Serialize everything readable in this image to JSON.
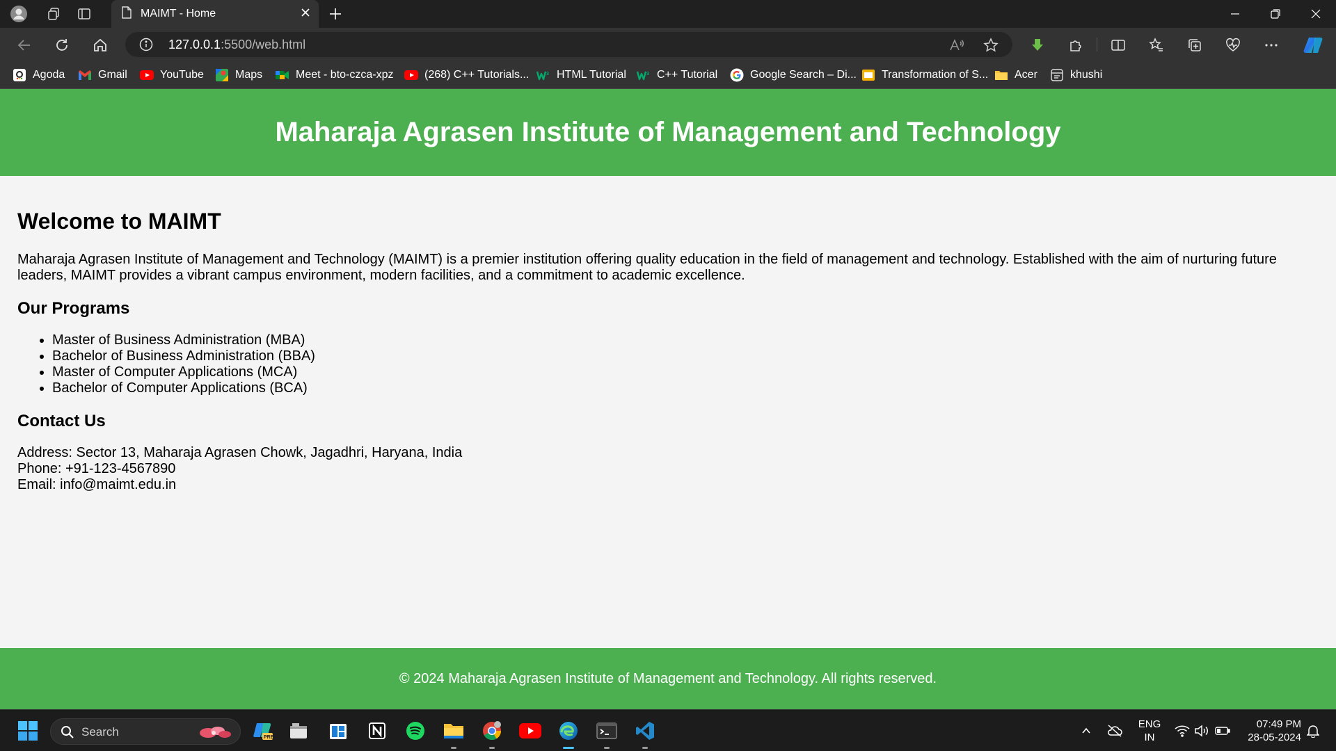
{
  "browser": {
    "tab_title": "MAIMT - Home",
    "url_host": "127.0.0.1",
    "url_path": ":5500/web.html",
    "favorites": [
      {
        "label": "Agoda",
        "icon": "agoda-icon"
      },
      {
        "label": "Gmail",
        "icon": "gmail-icon"
      },
      {
        "label": "YouTube",
        "icon": "youtube-icon"
      },
      {
        "label": "Maps",
        "icon": "maps-icon"
      },
      {
        "label": "Meet - bto-czca-xpz",
        "icon": "meet-icon"
      },
      {
        "label": "(268) C++ Tutorials...",
        "icon": "youtube-icon"
      },
      {
        "label": "HTML Tutorial",
        "icon": "w3schools-icon"
      },
      {
        "label": "C++ Tutorial",
        "icon": "w3schools-icon"
      },
      {
        "label": "Google Search – Di...",
        "icon": "google-icon"
      },
      {
        "label": "Transformation of S...",
        "icon": "slides-icon"
      },
      {
        "label": "Acer",
        "icon": "folder-icon"
      },
      {
        "label": "khushi",
        "icon": "app-icon"
      }
    ]
  },
  "site": {
    "header_title": "Maharaja Agrasen Institute of Management and Technology",
    "welcome_heading": "Welcome to MAIMT",
    "intro_paragraph": "Maharaja Agrasen Institute of Management and Technology (MAIMT) is a premier institution offering quality education in the field of management and technology. Established with the aim of nurturing future leaders, MAIMT provides a vibrant campus environment, modern facilities, and a commitment to academic excellence.",
    "programs_heading": "Our Programs",
    "programs": [
      "Master of Business Administration (MBA)",
      "Bachelor of Business Administration (BBA)",
      "Master of Computer Applications (MCA)",
      "Bachelor of Computer Applications (BCA)"
    ],
    "contact_heading": "Contact Us",
    "contact": {
      "address": "Address: Sector 13, Maharaja Agrasen Chowk, Jagadhri, Haryana, India",
      "phone": "Phone: +91-123-4567890",
      "email": "Email: info@maimt.edu.in"
    },
    "footer_text": "© 2024 Maharaja Agrasen Institute of Management and Technology. All rights reserved."
  },
  "taskbar": {
    "search_placeholder": "Search",
    "language": "ENG",
    "region": "IN",
    "time": "07:49 PM",
    "date": "28-05-2024"
  },
  "colors": {
    "header_green": "#4caf50",
    "page_background": "#f4f4f4",
    "chrome_dark": "#333333",
    "taskbar": "#1c1c1c"
  }
}
